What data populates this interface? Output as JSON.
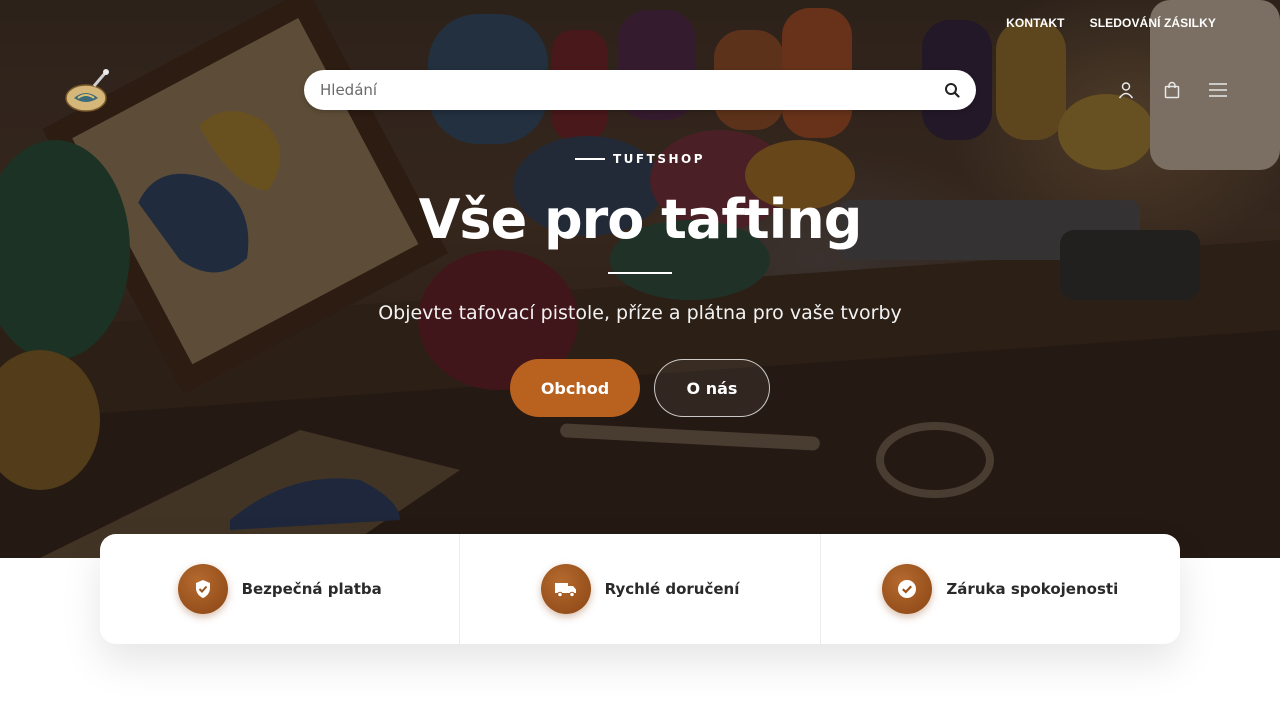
{
  "top_links": {
    "contact": "KONTAKT",
    "tracking": "SLEDOVÁNÍ ZÁSILKY"
  },
  "search": {
    "placeholder": "Hledání",
    "icon": "search-icon"
  },
  "header_icons": [
    "user-icon",
    "cart-icon",
    "menu-icon"
  ],
  "hero": {
    "eyebrow": "TUFTSHOP",
    "title": "Vše pro tafting",
    "subtitle": "Objevte tafovací pistole, příze a plátna pro vaše tvorby",
    "primary_button": "Obchod",
    "secondary_button": "O nás"
  },
  "features": [
    {
      "label": "Bezpečná platba",
      "icon": "shield-check-icon"
    },
    {
      "label": "Rychlé doručení",
      "icon": "truck-icon"
    },
    {
      "label": "Záruka spokojenosti",
      "icon": "check-circle-icon"
    }
  ],
  "colors": {
    "accent": "#b96220",
    "feature_badge": "#9a5218",
    "text_dark": "#2a2a2a"
  }
}
